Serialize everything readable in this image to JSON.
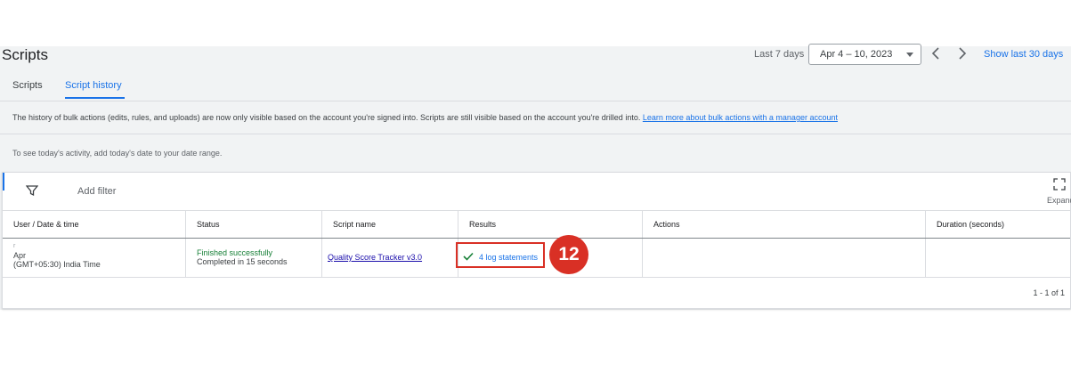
{
  "header": {
    "title": "Scripts",
    "range_label": "Last 7 days",
    "date_range": "Apr 4 – 10, 2023",
    "show_last": "Show last 30 days"
  },
  "tabs": [
    {
      "label": "Scripts",
      "active": false
    },
    {
      "label": "Script history",
      "active": true
    }
  ],
  "info_banner": {
    "text": "The history of bulk actions (edits, rules, and uploads) are now only visible based on the account you're signed into. Scripts are still visible based on the account you're drilled into.",
    "link": "Learn more about bulk actions with a manager account"
  },
  "hint": "To see today's activity, add today's date to your date range.",
  "toolbar": {
    "add_filter": "Add filter",
    "expand": "Expand"
  },
  "table": {
    "columns": [
      "User / Date & time",
      "Status",
      "Script name",
      "Results",
      "Actions",
      "Duration (seconds)"
    ],
    "rows": [
      {
        "user_line1": "r",
        "user_line2": "Apr",
        "user_tz": "(GMT+05:30) India Time",
        "status": "Finished successfully",
        "status_detail": "Completed in 15 seconds",
        "script_name": "Quality Score Tracker v3.0",
        "results": "4 log statements",
        "actions": "",
        "duration": ""
      }
    ]
  },
  "badge": "12",
  "pager": "1 - 1 of 1",
  "colors": {
    "accent": "#1a73e8",
    "success": "#188038",
    "highlight": "#d93025"
  }
}
